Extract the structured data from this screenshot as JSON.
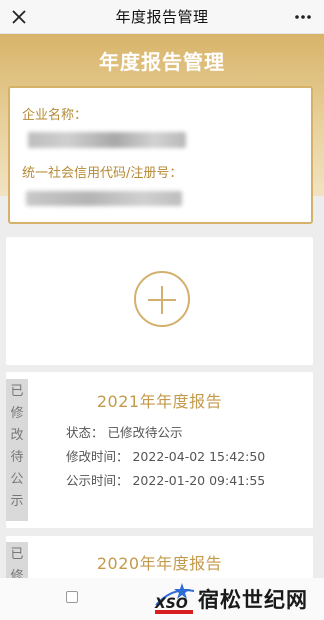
{
  "topbar": {
    "title": "年度报告管理"
  },
  "hero": {
    "title": "年度报告管理"
  },
  "company": {
    "name_label": "企业名称：",
    "credit_code_label": "统一社会信用代码/注册号："
  },
  "reports": [
    {
      "status_tag": [
        "已",
        "修",
        "改",
        "待",
        "公",
        "示"
      ],
      "title": "2021年年度报告",
      "status_line": "状态：  已修改待公示",
      "modified_line": "修改时间：  2022-04-02 15:42:50",
      "published_line": "公示时间：  2022-01-20 09:41:55"
    },
    {
      "status_tag": [
        "已",
        "修"
      ],
      "title": "2020年年度报告"
    }
  ],
  "watermark": {
    "brand_text": "宿松世纪网",
    "logo_text": "XSO"
  },
  "colors": {
    "gold": "#d3b06d",
    "gold_text": "#c39a4b",
    "label_gold": "#b58a36",
    "tag_gray": "#d9d9d9"
  },
  "icons": {
    "close": "close-icon",
    "more": "more-icon",
    "add": "add-icon"
  }
}
